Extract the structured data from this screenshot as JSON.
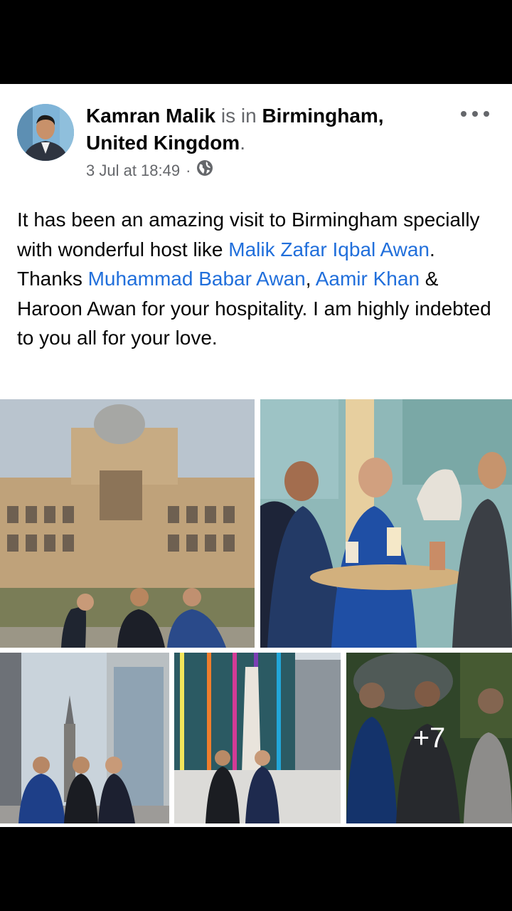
{
  "post": {
    "author": "Kamran Malik",
    "is_in": "is in",
    "location": "Birmingham, United Kingdom",
    "location_period": ".",
    "timestamp": "3 Jul at 18:49",
    "separator": "·",
    "audience_icon": "globe-icon",
    "more_icon": "more-options-icon",
    "text": {
      "p1": "It has been an amazing visit to Birmingham specially with wonderful host like ",
      "mention1": "Malik Zafar Iqbal Awan",
      "p2": ". Thanks ",
      "mention2": "Muhammad Babar Awan",
      "p3": ", ",
      "mention3": "Aamir Khan",
      "p4": " & Haroon Awan for your hospitality. I am highly indebted to you all for your love."
    },
    "more_photos_count": "+7"
  },
  "colors": {
    "link": "#216fdb",
    "secondary_text": "#65676b",
    "primary_text": "#050505"
  }
}
